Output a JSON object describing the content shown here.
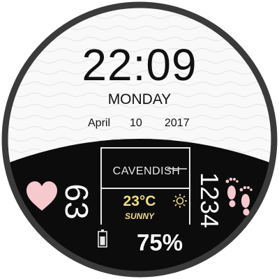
{
  "time": "22:09",
  "day": "MONDAY",
  "date": {
    "month": "April",
    "day": "10",
    "year": "2017"
  },
  "brand": "CAVENDISH",
  "weather": {
    "temperature": "23°C",
    "condition": "SUNNY",
    "icon": "sun-icon"
  },
  "heart_rate": "63",
  "steps": "1234",
  "battery": "75%",
  "icons": {
    "heart": "heart-icon",
    "steps": "footprints-icon",
    "battery": "battery-icon"
  },
  "colors": {
    "accent_pink": "#f6c9cf",
    "weather_yellow": "#f1dd86",
    "dark_panel": "#0c0c0c",
    "bezel": "#3a3a3a"
  }
}
